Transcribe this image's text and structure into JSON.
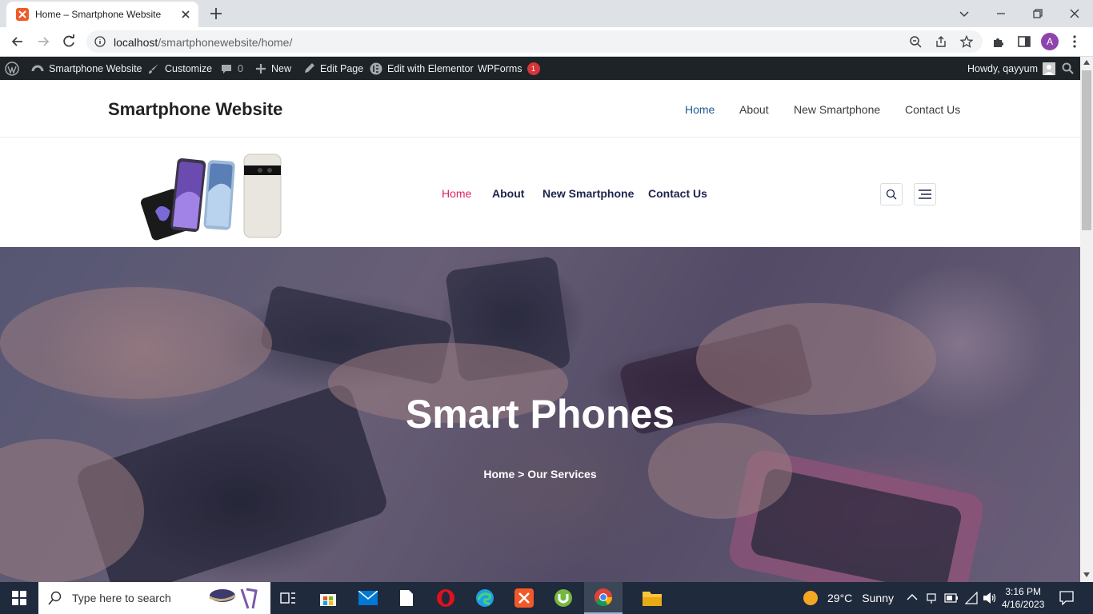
{
  "browser": {
    "tab_title": "Home – Smartphone Website",
    "url_host": "localhost",
    "url_path": "/smartphonewebsite/home/",
    "profile_initial": "A"
  },
  "admin_bar": {
    "site_name": "Smartphone Website",
    "customize": "Customize",
    "comments_count": "0",
    "new": "New",
    "edit_page": "Edit Page",
    "edit_elementor": "Edit with Elementor",
    "wpforms": "WPForms",
    "wpforms_badge": "1",
    "howdy": "Howdy, qayyum"
  },
  "header1": {
    "site_title": "Smartphone Website",
    "nav": [
      "Home",
      "About",
      "New Smartphone",
      "Contact Us"
    ],
    "active_color": "#1e5a94"
  },
  "header2": {
    "nav": [
      "Home",
      "About",
      "New Smartphone",
      "Contact Us"
    ],
    "active_color": "#e0245e"
  },
  "hero": {
    "title": "Smart Phones",
    "breadcrumb": "Home > Our Services"
  },
  "taskbar": {
    "search_placeholder": "Type here to search",
    "weather_temp": "29°C",
    "weather_desc": "Sunny",
    "time": "3:16 PM",
    "date": "4/16/2023"
  }
}
